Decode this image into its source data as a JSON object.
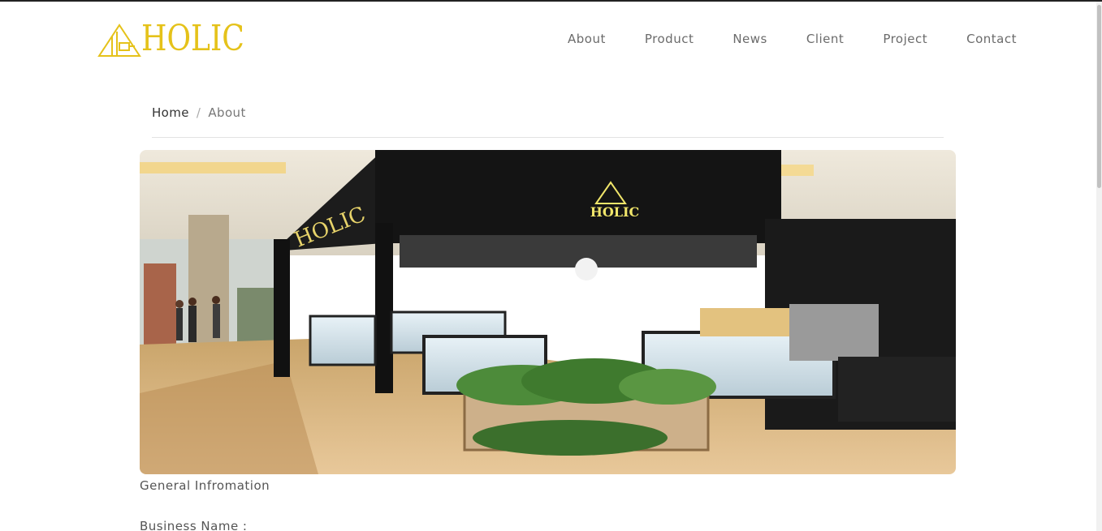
{
  "brand": {
    "logo_text": "HOLIC",
    "logo_color": "#e5c21a"
  },
  "nav": {
    "items": [
      {
        "label": "About"
      },
      {
        "label": "Product"
      },
      {
        "label": "News"
      },
      {
        "label": "Client"
      },
      {
        "label": "Project"
      },
      {
        "label": "Contact"
      }
    ]
  },
  "breadcrumb": {
    "home": "Home",
    "separator": "/",
    "current": "About"
  },
  "hero": {
    "image_icon": "storefront-photo",
    "sign_text": "HOLIC"
  },
  "content": {
    "section_title": "General Infromation",
    "business_name_label": "Business Name :"
  }
}
